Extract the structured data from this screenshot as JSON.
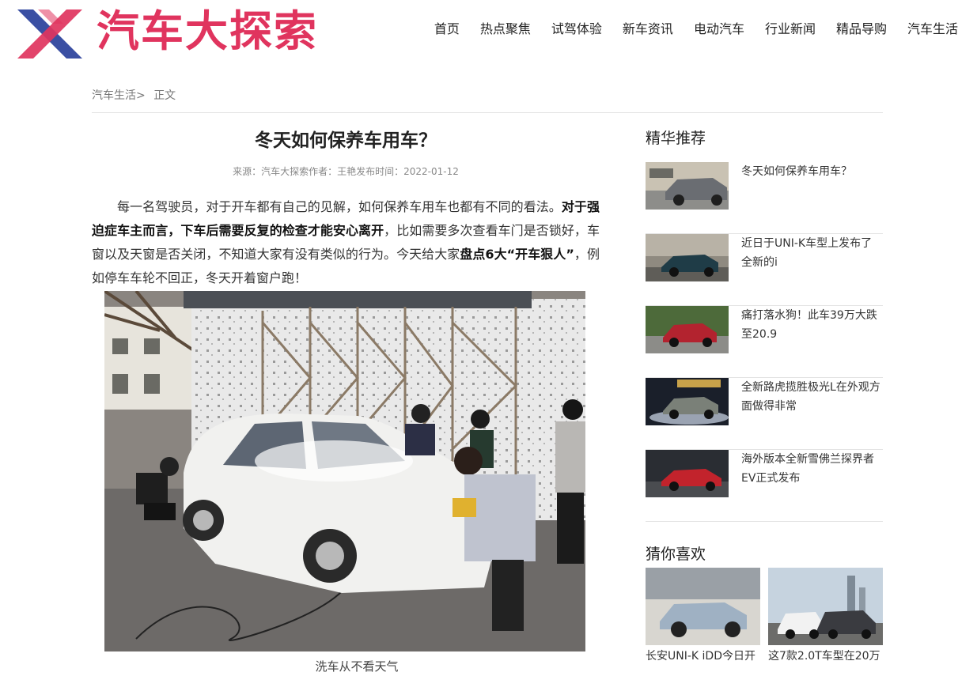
{
  "header": {
    "logo_text": "汽车大探索",
    "nav": [
      "首页",
      "热点聚焦",
      "试驾体验",
      "新车资讯",
      "电动汽车",
      "行业新闻",
      "精品导购",
      "汽车生活"
    ]
  },
  "breadcrumb": {
    "section": "汽车生活>",
    "current": "正文"
  },
  "article": {
    "title": "冬天如何保养车用车？",
    "meta": "来源：汽车大探索作者：王艳发布时间：2022-01-12",
    "p1_a": "每一名驾驶员，对于开车都有自己的见解，如何保养车用车也都有不同的看法。",
    "p1_b": "对于强迫症车主而言，下车后需要反复的检查才能安心离开",
    "p1_c": "，比如需要多次查看车门是否锁好，车窗以及天窗是否关闭，不知道大家有没有类似的行为。今天给大家",
    "p1_d": "盘点6大“开车狠人”",
    "p1_e": "，例如停车车轮不回正，冬天开着窗户跑！",
    "caption": "洗车从不看天气"
  },
  "sidebar": {
    "featured_title": "精华推荐",
    "featured": [
      {
        "title": "冬天如何保养车用车？"
      },
      {
        "title": "近日于UNI-K车型上发布了全新的i"
      },
      {
        "title": "痛打落水狗！此车39万大跌至20.9"
      },
      {
        "title": "全新路虎揽胜极光L在外观方面做得非常"
      },
      {
        "title": "海外版本全新雪佛兰探界者EV正式发布"
      }
    ],
    "guess_title": "猜你喜欢",
    "guess": [
      {
        "title": "长安UNI-K iDD今日开"
      },
      {
        "title": "这7款2.0T车型在20万"
      }
    ]
  },
  "colors": {
    "brand_red": "#e0345e",
    "brand_blue": "#3a4fa3"
  }
}
